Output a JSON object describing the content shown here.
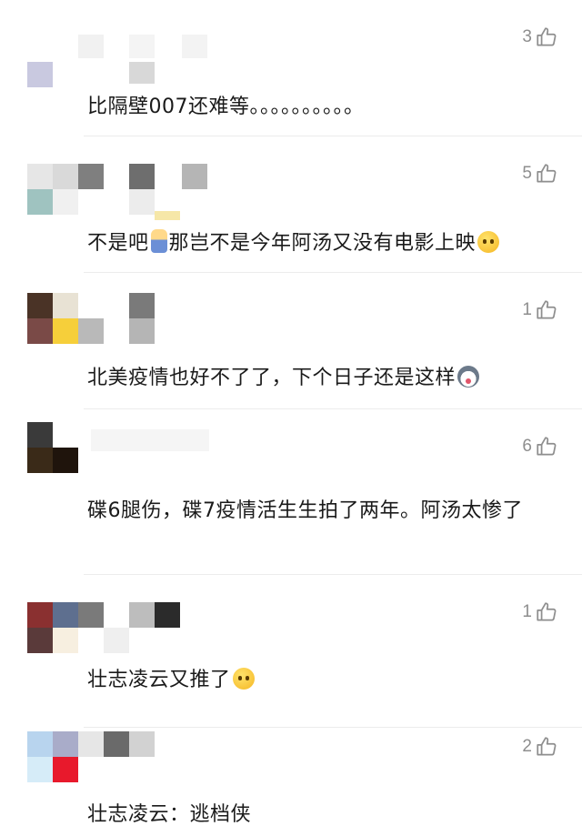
{
  "colors": {
    "text": "#1a1a1a",
    "meta": "#8e8e8e",
    "divider": "#ececec"
  },
  "comments": [
    {
      "likes": "3",
      "text": "比隔壁007还难等。。。。。。。。。。",
      "emojis": []
    },
    {
      "likes": "5",
      "text_parts": [
        "不是吧",
        "那岂不是今年阿汤又没有电影上映"
      ],
      "emojis": [
        "baby-emoji",
        "crying-emoji"
      ]
    },
    {
      "likes": "1",
      "text": "北美疫情也好不了了，下个日子还是这样",
      "emojis": [
        "husky-emoji"
      ]
    },
    {
      "likes": "6",
      "text": "碟6腿伤，碟7疫情活生生拍了两年。阿汤太惨了",
      "emojis": []
    },
    {
      "likes": "1",
      "text": "壮志凌云又推了",
      "emojis": [
        "laugh-cry-emoji"
      ]
    },
    {
      "likes": "2",
      "text": "壮志凌云：逃档侠",
      "emojis": []
    }
  ]
}
